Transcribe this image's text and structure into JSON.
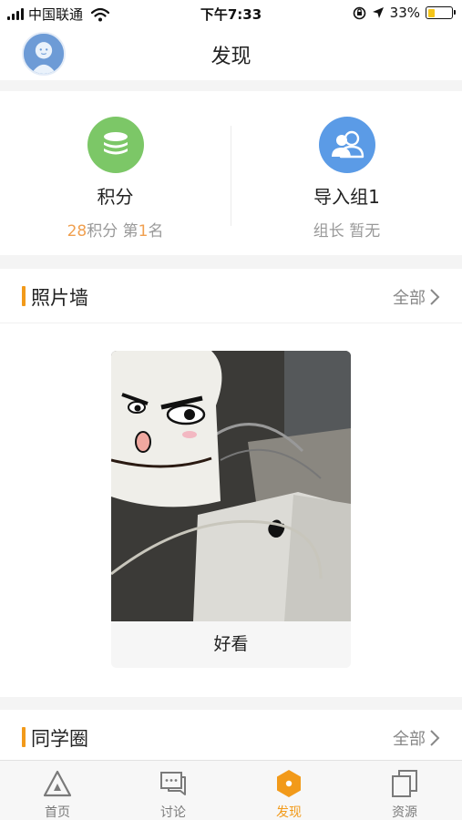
{
  "status_bar": {
    "carrier": "中国联通",
    "time": "下午7:33",
    "battery": "33%",
    "battery_level": 0.33
  },
  "header": {
    "title": "发现",
    "avatar_icon": "avatar-icon"
  },
  "stats": [
    {
      "name": "积分",
      "icon": "coins-icon",
      "icon_color": "#7cc767",
      "value": "28",
      "value_label": "积分",
      "rank_prefix": "第",
      "rank": "1",
      "rank_suffix": "名"
    },
    {
      "name": "导入组1",
      "icon": "group-icon",
      "icon_color": "#5b9be6",
      "sub": "组长 暂无"
    }
  ],
  "photo_wall": {
    "title": "照片墙",
    "more_label": "全部",
    "photos": [
      {
        "caption": "好看"
      }
    ]
  },
  "classmates": {
    "title": "同学圈",
    "more_label": "全部"
  },
  "tab_bar": {
    "tabs": [
      {
        "label": "首页",
        "icon": "home-triangle-icon"
      },
      {
        "label": "讨论",
        "icon": "discussion-icon"
      },
      {
        "label": "发现",
        "icon": "discover-icon",
        "active": true
      },
      {
        "label": "资源",
        "icon": "resources-icon"
      }
    ],
    "active_color": "#f29a1a",
    "inactive_color": "#7a7a7a"
  }
}
